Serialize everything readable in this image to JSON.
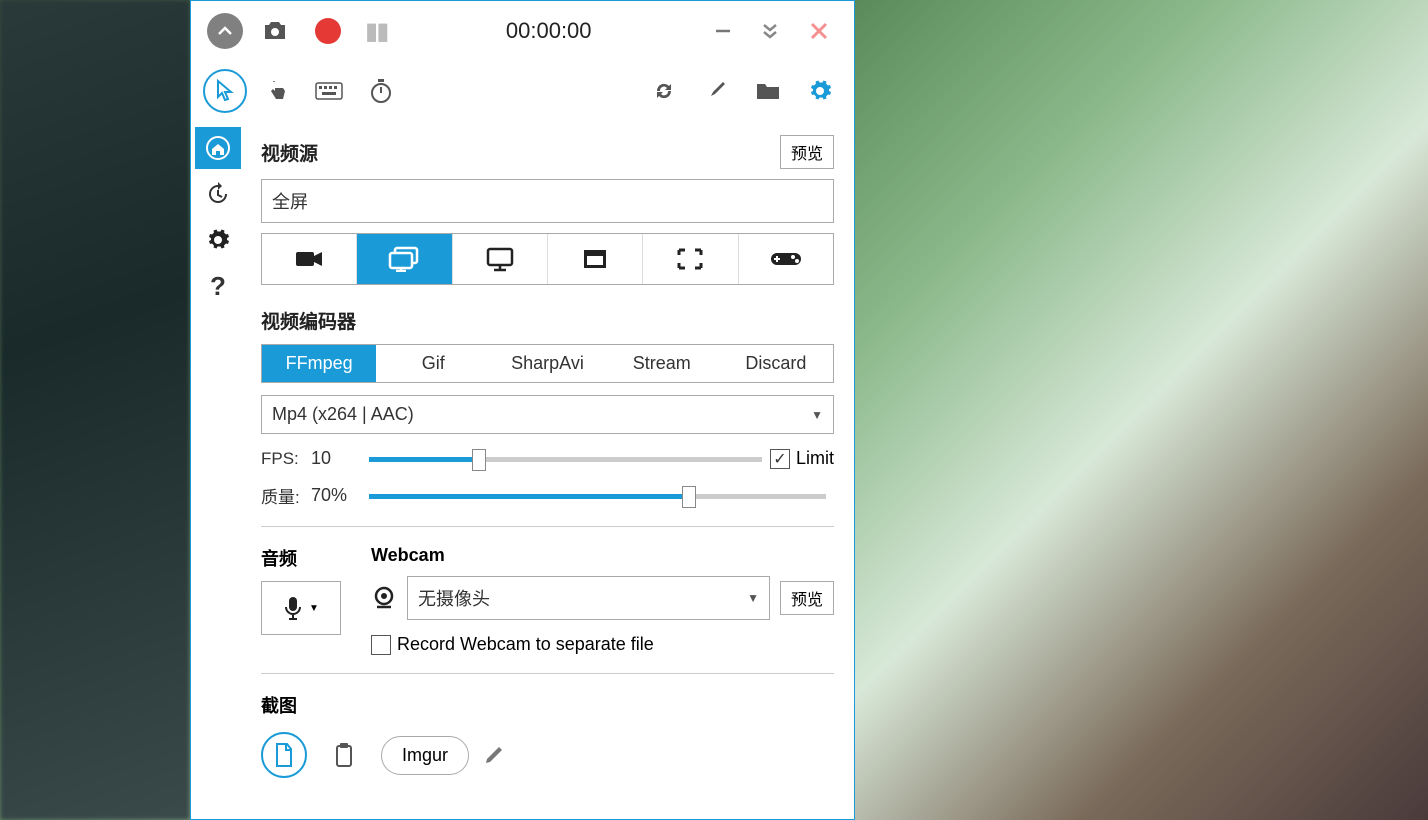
{
  "topbar": {
    "timer": "00:00:00"
  },
  "video_source": {
    "title": "视频源",
    "preview_btn": "预览",
    "selected": "全屏"
  },
  "encoder": {
    "title": "视频编码器",
    "tabs": [
      "FFmpeg",
      "Gif",
      "SharpAvi",
      "Stream",
      "Discard"
    ],
    "active_tab": 0,
    "codec": "Mp4 (x264 | AAC)"
  },
  "fps": {
    "label": "FPS:",
    "value": "10",
    "limit_label": "Limit",
    "limit_checked": true,
    "percent": 28
  },
  "quality": {
    "label": "质量:",
    "value": "70%",
    "percent": 70
  },
  "audio": {
    "title": "音频"
  },
  "webcam": {
    "title": "Webcam",
    "selected": "无摄像头",
    "preview_btn": "预览",
    "separate_label": "Record Webcam to separate file",
    "separate_checked": false
  },
  "screenshot": {
    "title": "截图",
    "imgur": "Imgur"
  }
}
